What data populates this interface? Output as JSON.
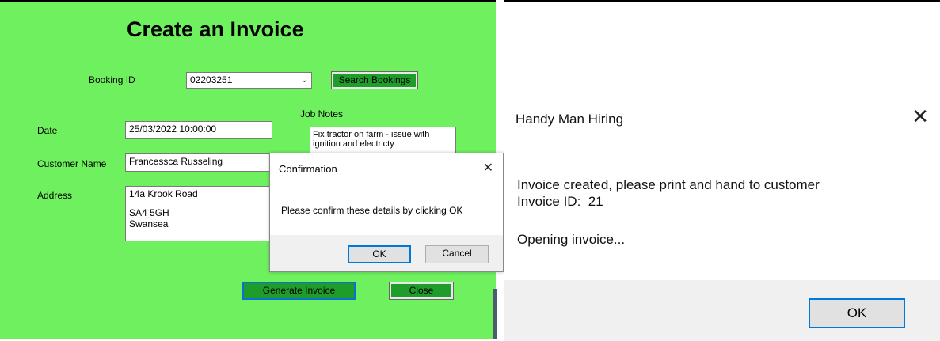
{
  "form": {
    "title": "Create an Invoice",
    "booking_id_label": "Booking ID",
    "booking_id_value": "02203251",
    "search_button": "Search Bookings",
    "date_label": "Date",
    "date_value": "25/03/2022 10:00:00",
    "customer_label": "Customer Name",
    "customer_value": "Francessca Russeling",
    "address_label": "Address",
    "address_lines": [
      "14a Krook Road",
      "",
      "SA4 5GH",
      "Swansea"
    ],
    "job_notes_label": "Job Notes",
    "job_notes_lines": [
      "Fix tractor on farm - issue with",
      "ignition and electricty"
    ],
    "generate_button": "Generate Invoice",
    "close_button": "Close",
    "background_color": "#6ef05f",
    "button_color": "#1f9d2b"
  },
  "confirm_dialog": {
    "title": "Confirmation",
    "message": "Please confirm these details by clicking OK",
    "ok": "OK",
    "cancel": "Cancel"
  },
  "message_box": {
    "title": "Handy Man Hiring",
    "lines": [
      "Invoice created, please print and hand to customer",
      "Invoice ID:  21"
    ],
    "line3": "Opening invoice...",
    "ok": "OK"
  },
  "icons": {
    "close": "close-icon",
    "dropdown": "chevron-down-icon"
  }
}
